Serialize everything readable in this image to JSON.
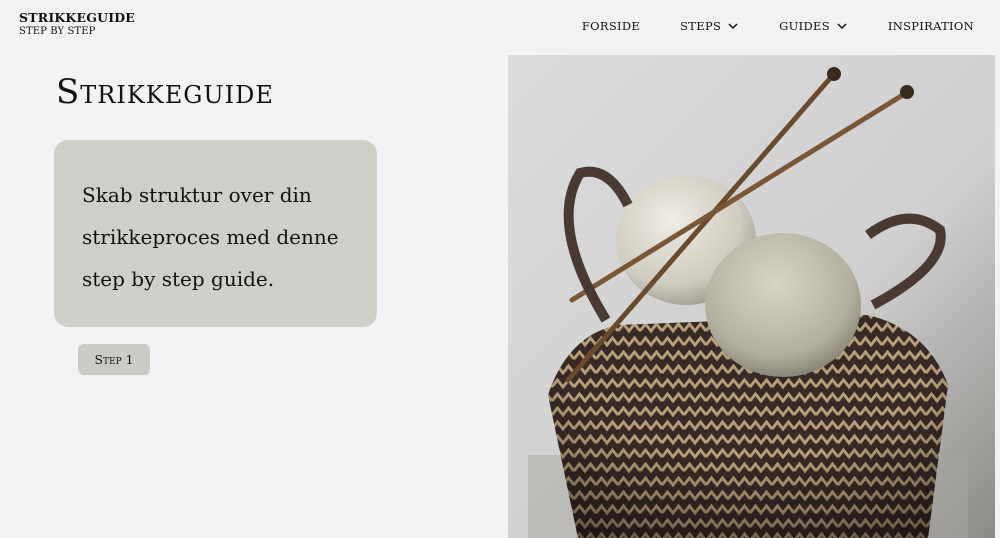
{
  "brand": {
    "title": "STRIKKEGUIDE",
    "subtitle": "STEP BY STEP"
  },
  "nav": {
    "items": [
      {
        "label": "FORSIDE"
      },
      {
        "label": "STEPS"
      },
      {
        "label": "GUIDES"
      },
      {
        "label": "INSPIRATION"
      }
    ]
  },
  "main": {
    "title": "Strikkeguide",
    "intro": "Skab struktur over din strikkeproces med denne step by step guide.",
    "step_button": "Step 1"
  },
  "hero": {
    "icon": "knitting-basket-photo"
  }
}
